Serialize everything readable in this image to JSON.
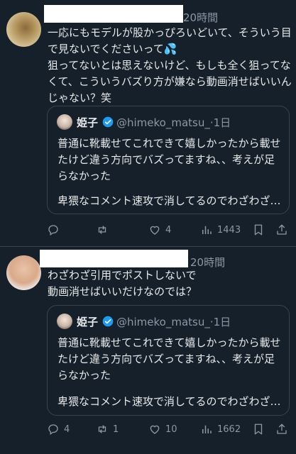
{
  "tweets": [
    {
      "time": "20時間",
      "text": "一応にもモデルが股かっぴろいどいて、そういう目で見ないでくださいって",
      "emoji": "💦",
      "text2": "狙ってないとは思えないけど、もしも全く狙ってなくて、こういうバズり方が嫌なら動画消せばいいんじゃない？笑",
      "quote": {
        "name": "姫子",
        "handle": "@himeko_matsu_·1日",
        "text": "普通に靴載せてこれできて嬉しかったから載せたけど違う方向でバズってますね、、考えが足らなかった",
        "truncated": "卑猥なコメント速攻で消してるのでわざわざ…"
      },
      "actions": {
        "reply": "",
        "repost": "",
        "like": "4",
        "views": "1443"
      }
    },
    {
      "time": "20時間",
      "text": "わざわざ引用でポストしないで\n動画消せばいいだけなのでは？",
      "quote": {
        "name": "姫子",
        "handle": "@himeko_matsu_·1日",
        "text": "普通に靴載せてこれできて嬉しかったから載せたけど違う方向でバズってますね、、考えが足らなかった",
        "truncated": "卑猥なコメント速攻で消してるのでわざわざ…"
      },
      "actions": {
        "reply": "4",
        "repost": "1",
        "like": "10",
        "views": "1662"
      }
    }
  ],
  "icons": {
    "reply": "reply-icon",
    "repost": "repost-icon",
    "like": "heart-icon",
    "views": "views-icon",
    "bookmark": "bookmark-icon",
    "share": "share-icon",
    "verified": "verified-badge-icon"
  },
  "colors": {
    "background": "#15202b",
    "text": "#e7e9ea",
    "muted": "#8b98a5",
    "border": "#38444d",
    "verified": "#1d9bf0"
  }
}
